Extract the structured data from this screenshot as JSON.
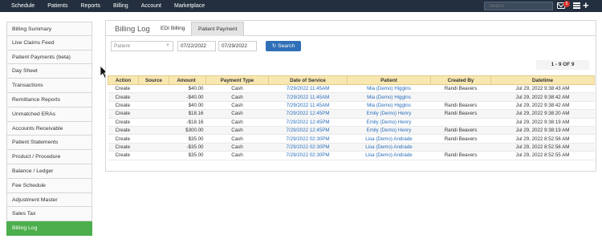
{
  "topnav": {
    "items": [
      "Schedule",
      "Patients",
      "Reports",
      "Billing",
      "Account",
      "Marketplace"
    ],
    "search_placeholder": "Search",
    "mail_badge": "5"
  },
  "sidebar": {
    "items": [
      {
        "label": "Billing Summary"
      },
      {
        "label": "Live Claims Feed"
      },
      {
        "label": "Patient Payments (beta)"
      },
      {
        "label": "Day Sheet"
      },
      {
        "label": "Transactions"
      },
      {
        "label": "Remittance Reports"
      },
      {
        "label": "Unmatched ERAs"
      },
      {
        "label": "Accounts Receivable"
      },
      {
        "label": "Patient Statements"
      },
      {
        "label": "Product / Procedure"
      },
      {
        "label": "Balance / Ledger"
      },
      {
        "label": "Fee Schedule"
      },
      {
        "label": "Adjustment Master"
      },
      {
        "label": "Sales Tax"
      },
      {
        "label": "Billing Log",
        "active": true
      }
    ]
  },
  "panel": {
    "title": "Billing Log",
    "tabs": [
      "EDI Billing",
      "Patient Payment"
    ]
  },
  "filters": {
    "patient_select": "Patient",
    "start_date": "07/22/2022",
    "end_date": "07/29/2022",
    "search_label": "Search"
  },
  "pager": "1 - 9 OF 9",
  "table": {
    "headers": [
      "Action",
      "Source",
      "Amount",
      "Payment Type",
      "Date of Service",
      "Patient",
      "Created By",
      "Datetime"
    ],
    "rows": [
      [
        "Create",
        "",
        "$40.00",
        "Cash",
        "7/29/2022 11:45AM",
        "Mia (Demo) Higgins",
        "Randi Beavers",
        "Jul 29, 2022 9:38:43 AM"
      ],
      [
        "Create",
        "",
        "-$40.00",
        "Cash",
        "7/29/2022 11:45AM",
        "Mia (Demo) Higgins",
        "",
        "Jul 29, 2022 9:38:42 AM"
      ],
      [
        "Create",
        "",
        "$40.00",
        "Cash",
        "7/29/2022 11:45AM",
        "Mia (Demo) Higgins",
        "Randi Beavers",
        "Jul 29, 2022 9:38:42 AM"
      ],
      [
        "Create",
        "",
        "$18.16",
        "Cash",
        "7/29/2022 12:45PM",
        "Emily (Demo) Henry",
        "Randi Beavers",
        "Jul 29, 2022 9:38:20 AM"
      ],
      [
        "Create",
        "",
        "-$18.16",
        "Cash",
        "7/29/2022 12:45PM",
        "Emily (Demo) Henry",
        "",
        "Jul 29, 2022 9:38:19 AM"
      ],
      [
        "Create",
        "",
        "$300.00",
        "Cash",
        "7/29/2022 12:45PM",
        "Emily (Demo) Henry",
        "Randi Beavers",
        "Jul 29, 2022 9:38:19 AM"
      ],
      [
        "Create",
        "",
        "$35.00",
        "Cash",
        "7/29/2022 02:30PM",
        "Lisa (Demo) Andrade",
        "Randi Beavers",
        "Jul 29, 2022 8:52:56 AM"
      ],
      [
        "Create",
        "",
        "-$35.00",
        "Cash",
        "7/29/2022 02:30PM",
        "Lisa (Demo) Andrade",
        "",
        "Jul 29, 2022 8:52:56 AM"
      ],
      [
        "Create",
        "",
        "$35.00",
        "Cash",
        "7/29/2022 02:30PM",
        "Lisa (Demo) Andrade",
        "Randi Beavers",
        "Jul 29, 2022 8:52:55 AM"
      ]
    ]
  },
  "colors": {
    "topbar": "#232f3e",
    "active_sidebar": "#4cae4c",
    "table_header": "#f8e7b1",
    "link": "#2a6ebb",
    "search_button": "#2f6fb7"
  }
}
